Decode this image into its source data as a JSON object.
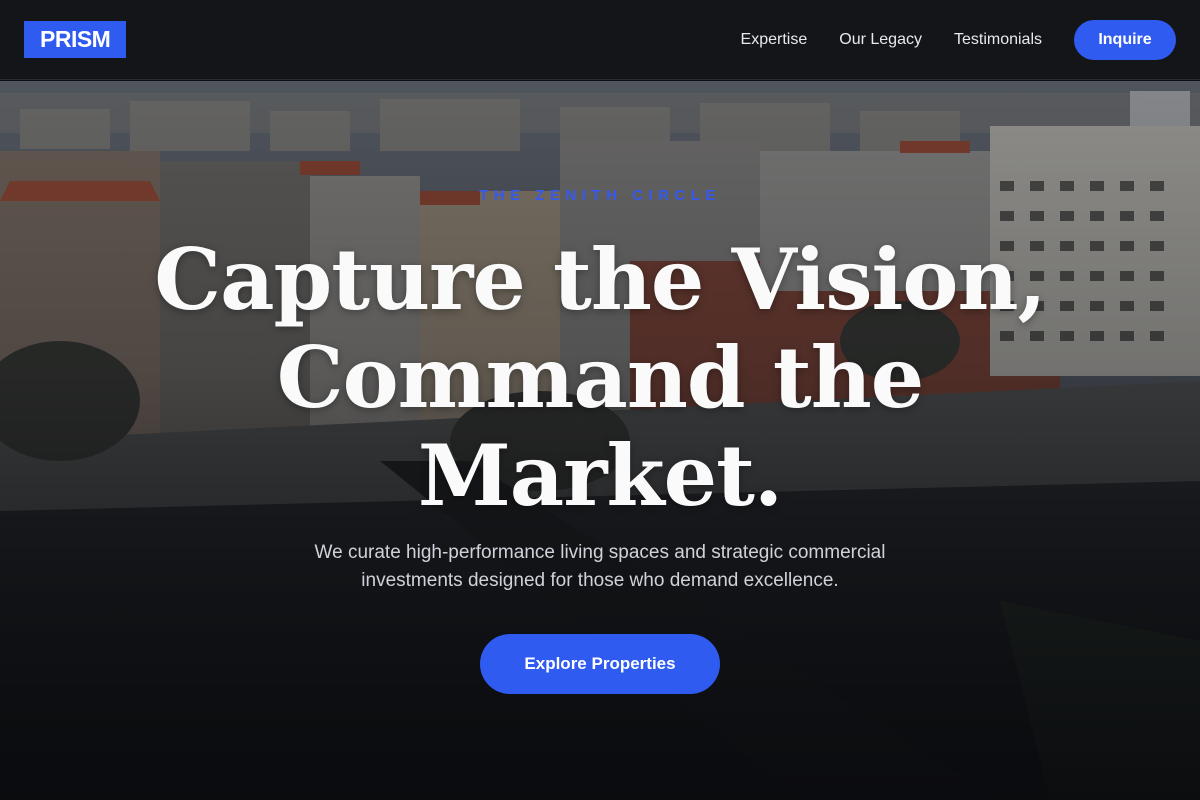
{
  "brand": {
    "logo_text": "PRISM",
    "accent": "#2f5bf0"
  },
  "nav": {
    "items": [
      {
        "label": "Expertise"
      },
      {
        "label": "Our Legacy"
      },
      {
        "label": "Testimonials"
      }
    ],
    "cta_label": "Inquire"
  },
  "hero": {
    "eyebrow": "THE ZENITH CIRCLE",
    "headline_line1": "Capture the Vision,",
    "headline_line2": "Command the",
    "headline_line3": "Market.",
    "subtext_line1": "We curate high-performance living spaces and strategic commercial",
    "subtext_line2": "investments designed for those who demand excellence.",
    "cta_label": "Explore Properties",
    "background_image": "city-skyline-photo"
  }
}
